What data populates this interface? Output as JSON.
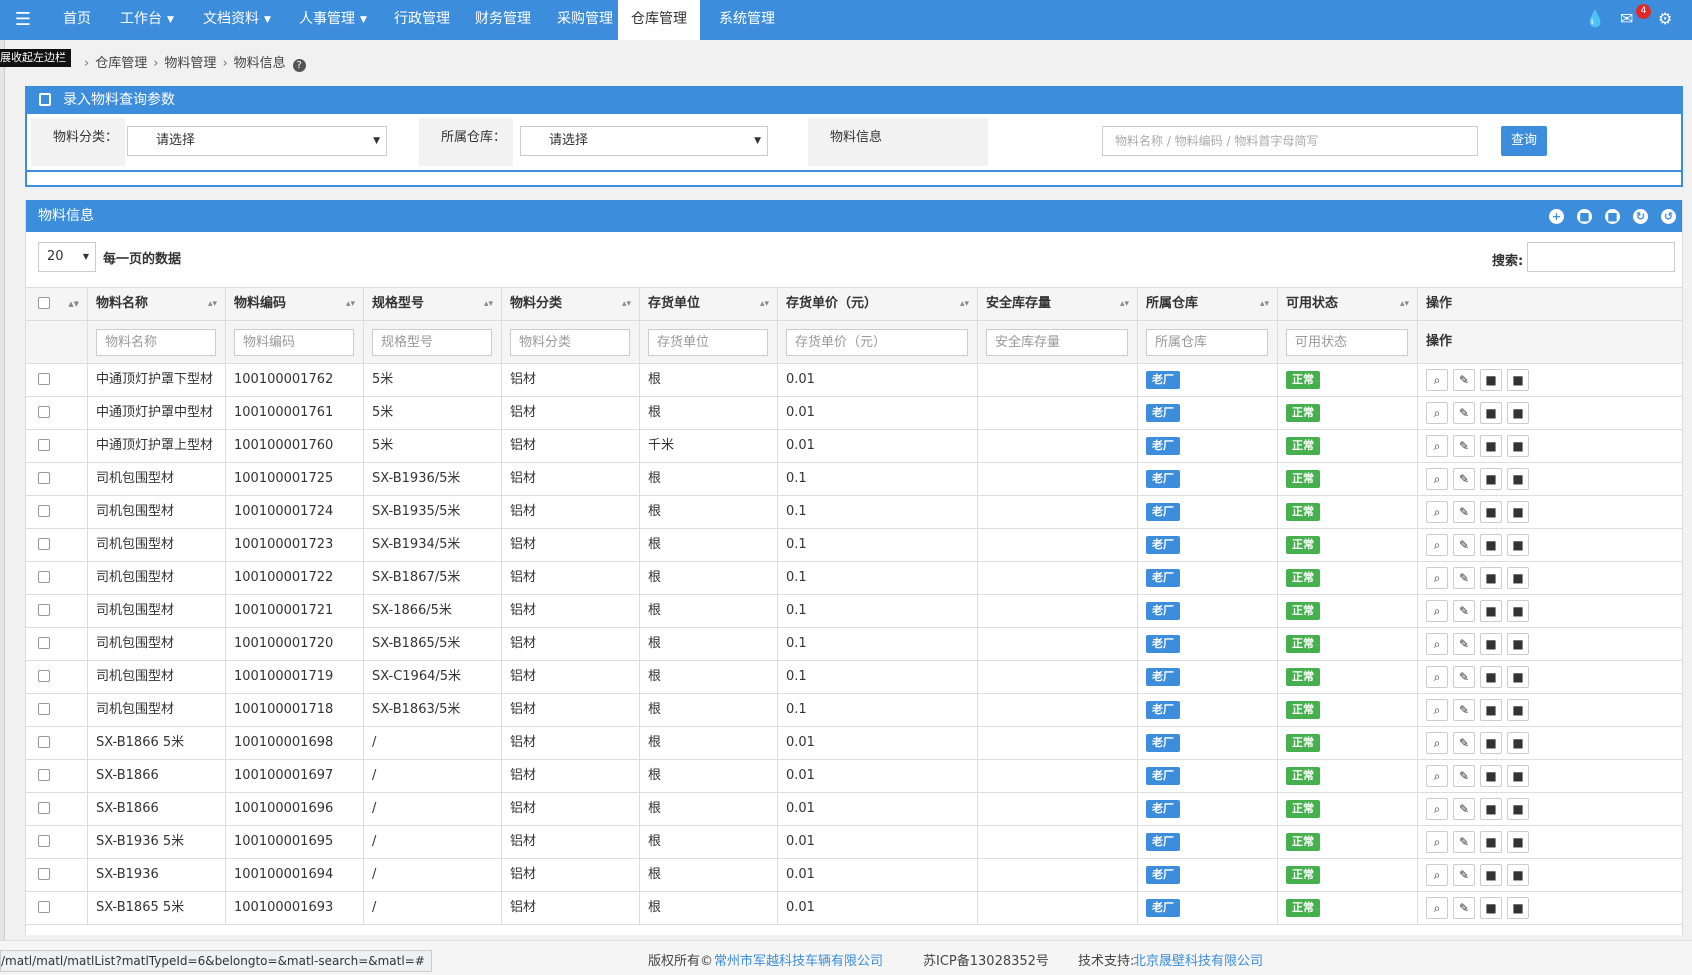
{
  "navbar": {
    "menu_icon": "menu-icon",
    "items": [
      {
        "label": "首页",
        "dropdown": false,
        "active": false
      },
      {
        "label": "工作台",
        "dropdown": true,
        "active": false
      },
      {
        "label": "文档资料",
        "dropdown": true,
        "active": false
      },
      {
        "label": "人事管理",
        "dropdown": true,
        "active": false
      },
      {
        "label": "行政管理",
        "dropdown": false,
        "active": false
      },
      {
        "label": "财务管理",
        "dropdown": false,
        "active": false
      },
      {
        "label": "采购管理",
        "dropdown": false,
        "active": false
      },
      {
        "label": "仓库管理",
        "dropdown": false,
        "active": true
      },
      {
        "label": "系统管理",
        "dropdown": false,
        "active": false
      }
    ],
    "message_count": "4",
    "right_icons": [
      "drop-icon",
      "envelope-icon",
      "gear-icon"
    ]
  },
  "tooltip": "展收起左边栏",
  "breadcrumb": [
    "仓库管理",
    "物料管理",
    "物料信息"
  ],
  "query_panel": {
    "title": "录入物料查询参数",
    "category_label": "物料分类：",
    "category_value": "请选择",
    "warehouse_label": "所属仓库：",
    "warehouse_value": "请选择",
    "info_label": "物料信息",
    "info_placeholder": "物料名称 / 物料编码 / 物料首字母简写",
    "query_button": "查询"
  },
  "list_panel": {
    "title": "物料信息",
    "tool_icons": [
      "plus-circle-icon",
      "lock-icon",
      "lock-icon",
      "refresh-icon",
      "reload-icon"
    ],
    "page_size": "20",
    "page_size_label": "每一页的数据",
    "search_label": "搜索:"
  },
  "table": {
    "columns": [
      "物料名称",
      "物料编码",
      "规格型号",
      "物料分类",
      "存货单位",
      "存货单价（元）",
      "安全库存量",
      "所属仓库",
      "可用状态",
      "操作"
    ],
    "filters": [
      "物料名称",
      "物料编码",
      "规格型号",
      "物料分类",
      "存货单位",
      "存货单价（元）",
      "安全库存量",
      "所属仓库",
      "可用状态"
    ],
    "filter_ops_label": "操作",
    "rows": [
      {
        "name": "中通顶灯护罩下型材",
        "code": "100100001762",
        "spec": "5米",
        "category": "铝材",
        "unit": "根",
        "price": "0.01",
        "safety": "",
        "warehouse": "老厂",
        "status": "正常"
      },
      {
        "name": "中通顶灯护罩中型材",
        "code": "100100001761",
        "spec": "5米",
        "category": "铝材",
        "unit": "根",
        "price": "0.01",
        "safety": "",
        "warehouse": "老厂",
        "status": "正常"
      },
      {
        "name": "中通顶灯护罩上型材",
        "code": "100100001760",
        "spec": "5米",
        "category": "铝材",
        "unit": "千米",
        "price": "0.01",
        "safety": "",
        "warehouse": "老厂",
        "status": "正常"
      },
      {
        "name": "司机包围型材",
        "code": "100100001725",
        "spec": "SX-B1936/5米",
        "category": "铝材",
        "unit": "根",
        "price": "0.1",
        "safety": "",
        "warehouse": "老厂",
        "status": "正常"
      },
      {
        "name": "司机包围型材",
        "code": "100100001724",
        "spec": "SX-B1935/5米",
        "category": "铝材",
        "unit": "根",
        "price": "0.1",
        "safety": "",
        "warehouse": "老厂",
        "status": "正常"
      },
      {
        "name": "司机包围型材",
        "code": "100100001723",
        "spec": "SX-B1934/5米",
        "category": "铝材",
        "unit": "根",
        "price": "0.1",
        "safety": "",
        "warehouse": "老厂",
        "status": "正常"
      },
      {
        "name": "司机包围型材",
        "code": "100100001722",
        "spec": "SX-B1867/5米",
        "category": "铝材",
        "unit": "根",
        "price": "0.1",
        "safety": "",
        "warehouse": "老厂",
        "status": "正常"
      },
      {
        "name": "司机包围型材",
        "code": "100100001721",
        "spec": "SX-1866/5米",
        "category": "铝材",
        "unit": "根",
        "price": "0.1",
        "safety": "",
        "warehouse": "老厂",
        "status": "正常"
      },
      {
        "name": "司机包围型材",
        "code": "100100001720",
        "spec": "SX-B1865/5米",
        "category": "铝材",
        "unit": "根",
        "price": "0.1",
        "safety": "",
        "warehouse": "老厂",
        "status": "正常"
      },
      {
        "name": "司机包围型材",
        "code": "100100001719",
        "spec": "SX-C1964/5米",
        "category": "铝材",
        "unit": "根",
        "price": "0.1",
        "safety": "",
        "warehouse": "老厂",
        "status": "正常"
      },
      {
        "name": "司机包围型材",
        "code": "100100001718",
        "spec": "SX-B1863/5米",
        "category": "铝材",
        "unit": "根",
        "price": "0.1",
        "safety": "",
        "warehouse": "老厂",
        "status": "正常"
      },
      {
        "name": "SX-B1866 5米",
        "code": "100100001698",
        "spec": "/",
        "category": "铝材",
        "unit": "根",
        "price": "0.01",
        "safety": "",
        "warehouse": "老厂",
        "status": "正常"
      },
      {
        "name": "SX-B1866",
        "code": "100100001697",
        "spec": "/",
        "category": "铝材",
        "unit": "根",
        "price": "0.01",
        "safety": "",
        "warehouse": "老厂",
        "status": "正常"
      },
      {
        "name": "SX-B1866",
        "code": "100100001696",
        "spec": "/",
        "category": "铝材",
        "unit": "根",
        "price": "0.01",
        "safety": "",
        "warehouse": "老厂",
        "status": "正常"
      },
      {
        "name": "SX-B1936 5米",
        "code": "100100001695",
        "spec": "/",
        "category": "铝材",
        "unit": "根",
        "price": "0.01",
        "safety": "",
        "warehouse": "老厂",
        "status": "正常"
      },
      {
        "name": "SX-B1936",
        "code": "100100001694",
        "spec": "/",
        "category": "铝材",
        "unit": "根",
        "price": "0.01",
        "safety": "",
        "warehouse": "老厂",
        "status": "正常"
      },
      {
        "name": "SX-B1865 5米",
        "code": "100100001693",
        "spec": "/",
        "category": "铝材",
        "unit": "根",
        "price": "0.01",
        "safety": "",
        "warehouse": "老厂",
        "status": "正常"
      }
    ],
    "row_actions": [
      "search-icon",
      "edit-icon",
      "lock-icon",
      "lock-icon"
    ]
  },
  "footer": {
    "copyright_prefix": "版权所有©",
    "company": "常州市军越科技车辆有限公司",
    "icp": "苏ICP备13028352号",
    "support_prefix": "技术支持:",
    "support_company": "北京晟壁科技有限公司"
  },
  "status_url": "/matl/matl/matlList?matlTypeId=6&belongto=&matl-search=&matl=#",
  "colors": {
    "primary": "#3c8ddc",
    "success": "#46b04f",
    "badge": "#e02a2a"
  }
}
